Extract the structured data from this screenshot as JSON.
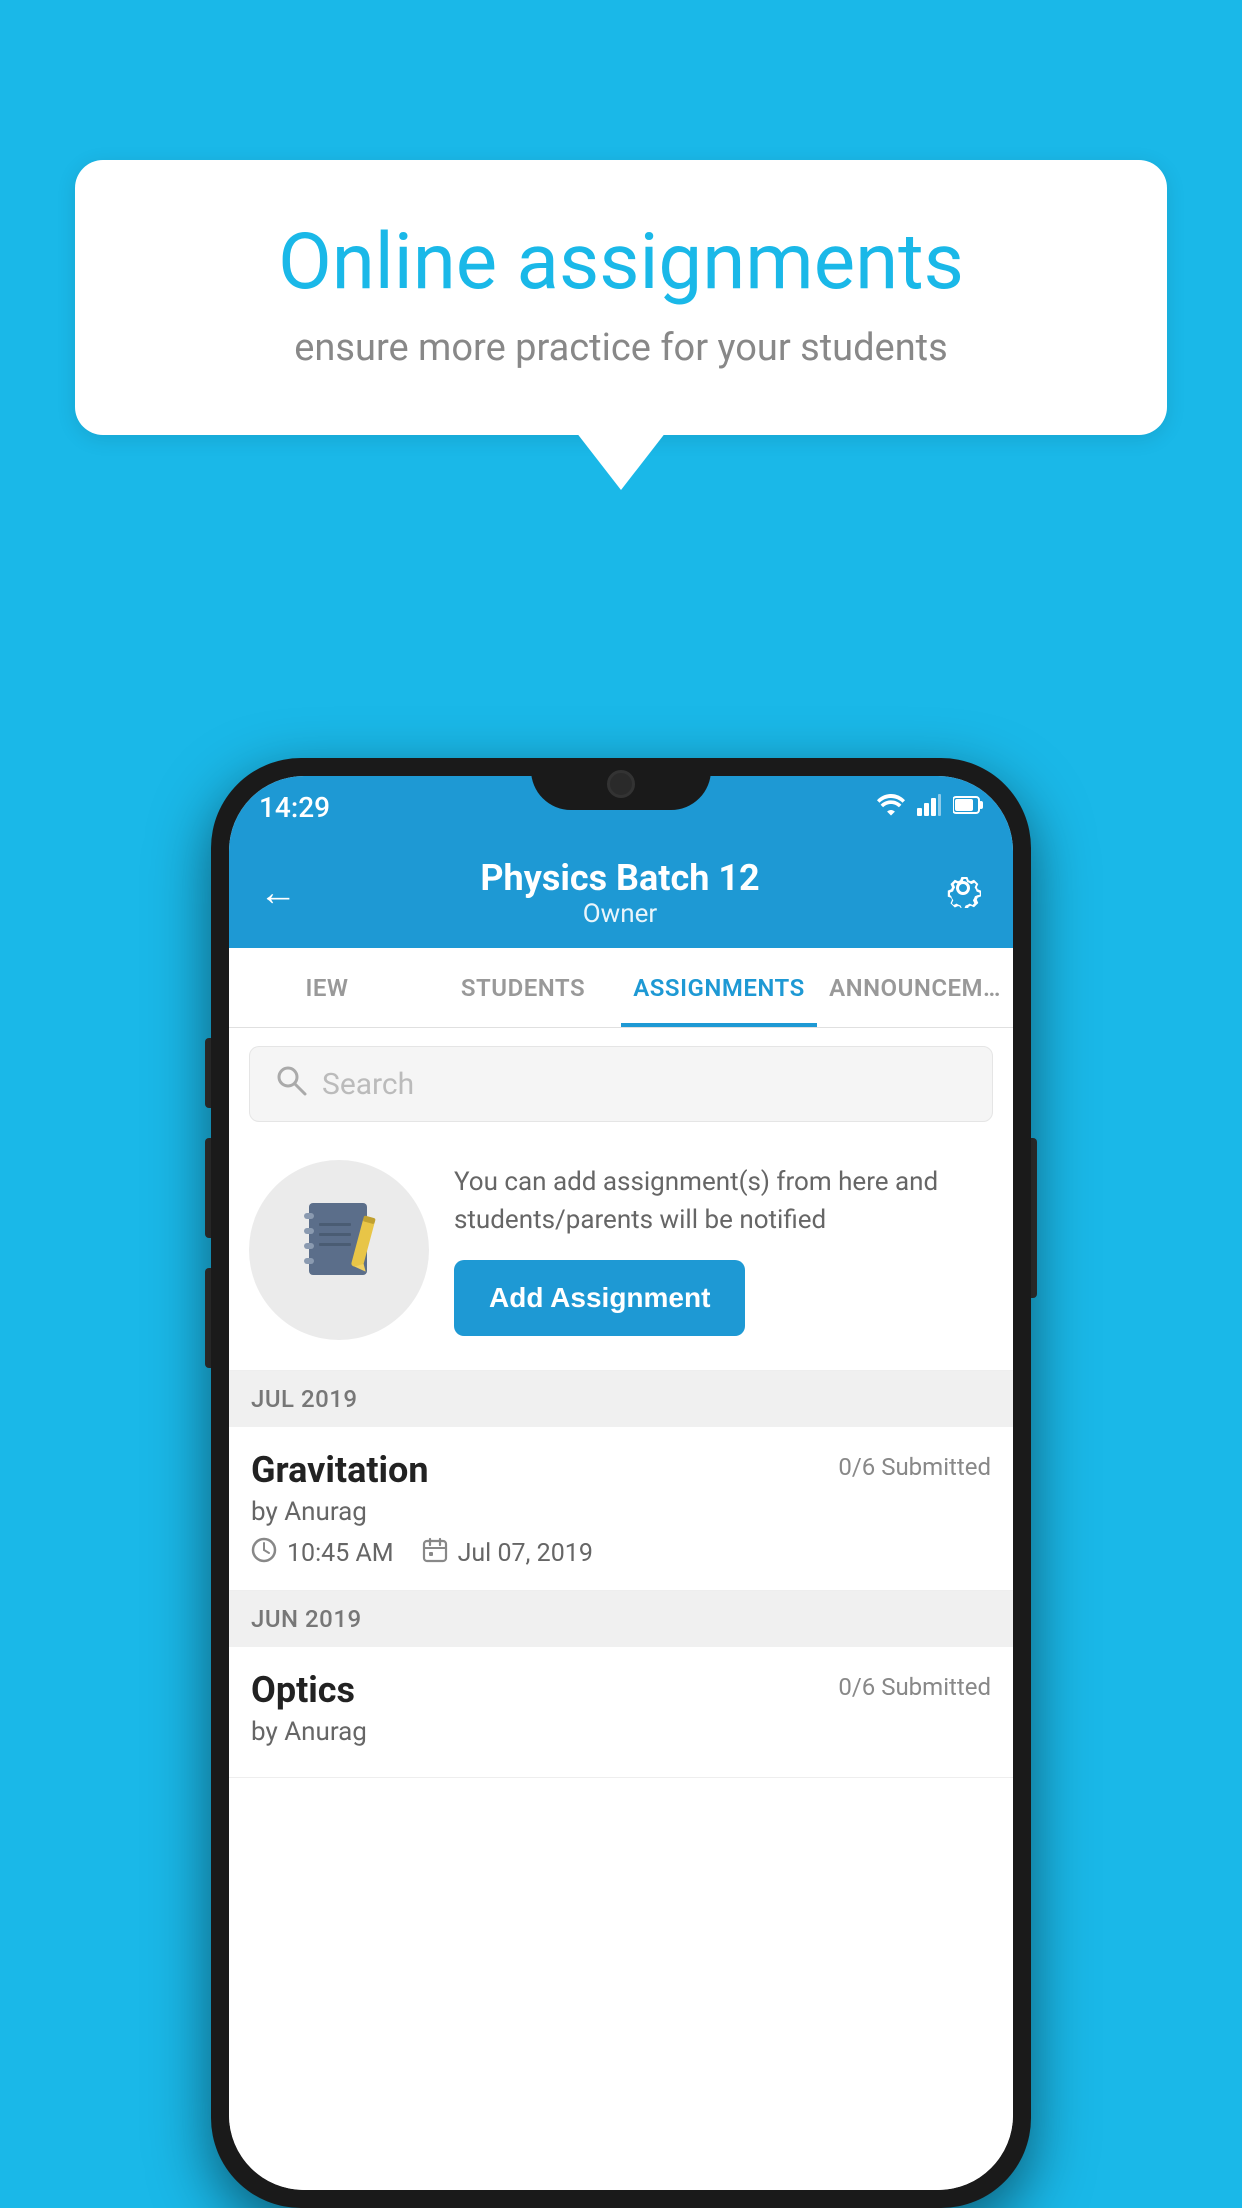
{
  "background_color": "#1ab8e8",
  "speech_bubble": {
    "title": "Online assignments",
    "subtitle": "ensure more practice for your students"
  },
  "phone": {
    "status_bar": {
      "time": "14:29",
      "wifi_icon": "▼",
      "signal_icon": "▲",
      "battery_icon": "▮"
    },
    "header": {
      "title": "Physics Batch 12",
      "subtitle": "Owner",
      "back_icon": "←",
      "gear_icon": "⚙"
    },
    "tabs": [
      {
        "label": "IEW",
        "active": false
      },
      {
        "label": "STUDENTS",
        "active": false
      },
      {
        "label": "ASSIGNMENTS",
        "active": true
      },
      {
        "label": "ANNOUNCEM…",
        "active": false
      }
    ],
    "search": {
      "placeholder": "Search"
    },
    "promo": {
      "description": "You can add assignment(s) from here and students/parents will be notified",
      "button_label": "Add Assignment"
    },
    "sections": [
      {
        "month": "JUL 2019",
        "assignments": [
          {
            "name": "Gravitation",
            "submitted": "0/6 Submitted",
            "by": "by Anurag",
            "time": "10:45 AM",
            "date": "Jul 07, 2019"
          }
        ]
      },
      {
        "month": "JUN 2019",
        "assignments": [
          {
            "name": "Optics",
            "submitted": "0/6 Submitted",
            "by": "by Anurag",
            "time": "",
            "date": ""
          }
        ]
      }
    ]
  }
}
